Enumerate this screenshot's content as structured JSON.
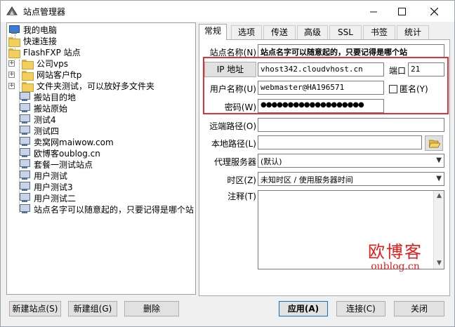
{
  "window": {
    "title": "站点管理器"
  },
  "tree": {
    "items": [
      {
        "label": "我的电脑",
        "icon": "computer-icon"
      },
      {
        "label": "快速连接",
        "icon": "folder-icon"
      },
      {
        "label": "FlashFXP 站点",
        "icon": "folder-icon"
      },
      {
        "label": "公司vps",
        "icon": "folder-icon"
      },
      {
        "label": "网站客户ftp",
        "icon": "folder-icon"
      },
      {
        "label": "文件夹测试，可以放好多文件夹",
        "icon": "folder-icon"
      },
      {
        "label": "搬站目的地",
        "icon": "site-icon"
      },
      {
        "label": "搬站原始",
        "icon": "site-icon"
      },
      {
        "label": "测试4",
        "icon": "site-icon"
      },
      {
        "label": "测试四",
        "icon": "site-icon"
      },
      {
        "label": "卖窝网maiwow.com",
        "icon": "site-icon"
      },
      {
        "label": "欧博客oublog.cn",
        "icon": "site-icon"
      },
      {
        "label": "套餐一测试站点",
        "icon": "site-icon"
      },
      {
        "label": "用户测试",
        "icon": "site-icon"
      },
      {
        "label": "用户测试3",
        "icon": "site-icon"
      },
      {
        "label": "用户测试二",
        "icon": "site-icon"
      },
      {
        "label": "站点名字可以随意起的，只要记得是哪个站",
        "icon": "site-icon"
      }
    ]
  },
  "tabs": [
    "常规",
    "选项",
    "传送",
    "高级",
    "SSL",
    "书签",
    "统计"
  ],
  "form": {
    "site_name_label": "站点名称(N)",
    "site_name_value": "站点名字可以随意起的，只要记得是哪个站",
    "ip_button": "IP 地址",
    "ip_value": "vhost342.cloudvhost.cn",
    "port_label": "端口",
    "port_value": "21",
    "user_label": "用户名称(U)",
    "user_value": "webmaster@HA196571",
    "anon_label": "匿名(Y)",
    "password_label": "密码(W)",
    "password_value": "●●●●●●●●●●●●●●●●●●●",
    "remote_path_label": "远端路径(O)",
    "remote_path_value": "",
    "local_path_label": "本地路径(L)",
    "local_path_value": "",
    "proxy_label": "代理服务器",
    "proxy_value": "(默认)",
    "timezone_label": "时区(Z)",
    "timezone_value": "未知时区 / 使用服务器时间",
    "notes_label": "注释(T)",
    "notes_value": ""
  },
  "buttons": {
    "new_site": "新建站点(S)",
    "new_group": "新建组(G)",
    "delete": "删除",
    "apply": "应用(A)",
    "connect": "连接(C)",
    "close": "关闭"
  },
  "watermark": {
    "main": "欧博客",
    "sub": "oublog.cn"
  },
  "colors": {
    "highlight_border": "#e0303a",
    "watermark": "#e31b1b"
  }
}
